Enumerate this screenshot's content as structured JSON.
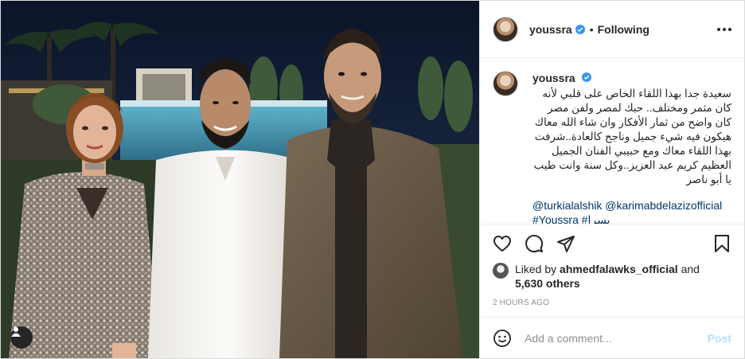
{
  "header": {
    "username": "youssra",
    "follow_status": "Following",
    "separator": "•"
  },
  "caption": {
    "username": "youssra",
    "text": "سعيدة جدا بهذا اللقاء الخاص على قلبي لأنه كان مثمر ومختلف.. حبك لمصر ولفن مصر كان واضح من ثمار الأفكار وان شاء الله معاك هيكون فيه شيء جميل وناجح كالعادة..شرفت بهذا اللقاء معاك ومع حبيبي الفنان الجميل العظيم كريم عبد العزيز..وكل سنة وانت طيب يا أبو ناصر",
    "mention_1": "@turkialalshik",
    "mention_2": "@karimabdelazizofficial",
    "hashtag_1": "#Youssra",
    "hashtag_2": "#يسرا",
    "time_short": "2h"
  },
  "likes": {
    "prefix": "Liked by",
    "liker": "ahmedfalawks_official",
    "conjunction": "and",
    "count": "5,630 others"
  },
  "post_time": "2 HOURS AGO",
  "comment": {
    "placeholder": "Add a comment...",
    "post_label": "Post"
  },
  "icons": {
    "verified": "verified-badge-icon",
    "more": "more-options-icon",
    "like": "heart-icon",
    "comment": "comment-bubble-icon",
    "share": "paper-plane-icon",
    "save": "bookmark-icon",
    "emoji": "smiley-icon",
    "tags": "user-tag-icon"
  },
  "colors": {
    "link": "#00376b",
    "verified_blue": "#3897f0",
    "post_button": "#b2dffc",
    "muted": "#8e8e8e"
  }
}
